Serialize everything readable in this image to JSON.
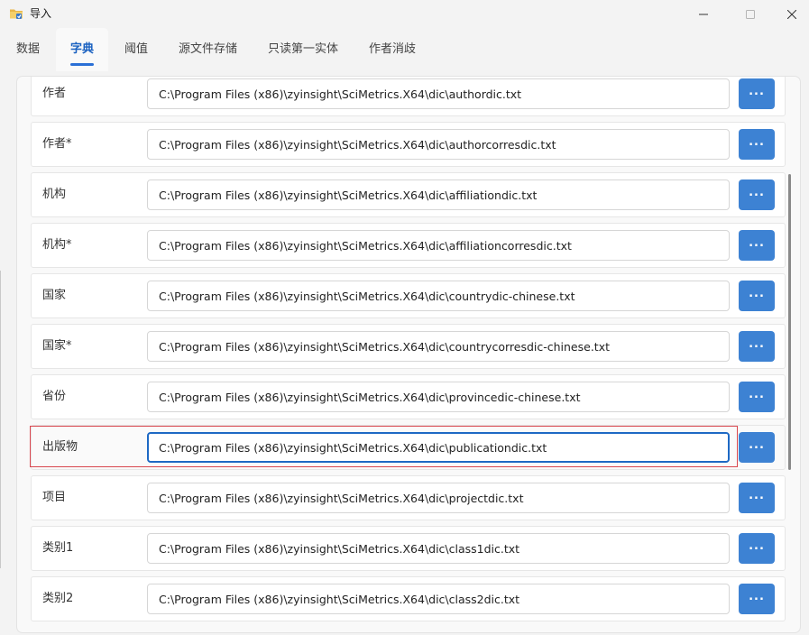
{
  "window": {
    "title": "导入",
    "icon": "folder-icon"
  },
  "tabs": [
    {
      "label": "数据",
      "active": false
    },
    {
      "label": "字典",
      "active": true
    },
    {
      "label": "阈值",
      "active": false
    },
    {
      "label": "源文件存储",
      "active": false
    },
    {
      "label": "只读第一实体",
      "active": false
    },
    {
      "label": "作者消歧",
      "active": false
    }
  ],
  "dictionary_rows": [
    {
      "label": "作者",
      "path": "C:\\Program Files (x86)\\zyinsight\\SciMetrics.X64\\dic\\authordic.txt",
      "button": "..."
    },
    {
      "label": "作者*",
      "path": "C:\\Program Files (x86)\\zyinsight\\SciMetrics.X64\\dic\\authorcorresdic.txt",
      "button": "..."
    },
    {
      "label": "机构",
      "path": "C:\\Program Files (x86)\\zyinsight\\SciMetrics.X64\\dic\\affiliationdic.txt",
      "button": "..."
    },
    {
      "label": "机构*",
      "path": "C:\\Program Files (x86)\\zyinsight\\SciMetrics.X64\\dic\\affiliationcorresdic.txt",
      "button": "..."
    },
    {
      "label": "国家",
      "path": "C:\\Program Files (x86)\\zyinsight\\SciMetrics.X64\\dic\\countrydic-chinese.txt",
      "button": "..."
    },
    {
      "label": "国家*",
      "path": "C:\\Program Files (x86)\\zyinsight\\SciMetrics.X64\\dic\\countrycorresdic-chinese.txt",
      "button": "..."
    },
    {
      "label": "省份",
      "path": "C:\\Program Files (x86)\\zyinsight\\SciMetrics.X64\\dic\\provincedic-chinese.txt",
      "button": "..."
    },
    {
      "label": "出版物",
      "path": "C:\\Program Files (x86)\\zyinsight\\SciMetrics.X64\\dic\\publicationdic.txt",
      "button": "...",
      "focused": true
    },
    {
      "label": "项目",
      "path": "C:\\Program Files (x86)\\zyinsight\\SciMetrics.X64\\dic\\projectdic.txt",
      "button": "..."
    },
    {
      "label": "类别1",
      "path": "C:\\Program Files (x86)\\zyinsight\\SciMetrics.X64\\dic\\class1dic.txt",
      "button": "..."
    },
    {
      "label": "类别2",
      "path": "C:\\Program Files (x86)\\zyinsight\\SciMetrics.X64\\dic\\class2dic.txt",
      "button": "..."
    }
  ],
  "colors": {
    "accent": "#1b62c1",
    "button": "#3d82d3",
    "focus_outline": "#d9474f"
  }
}
